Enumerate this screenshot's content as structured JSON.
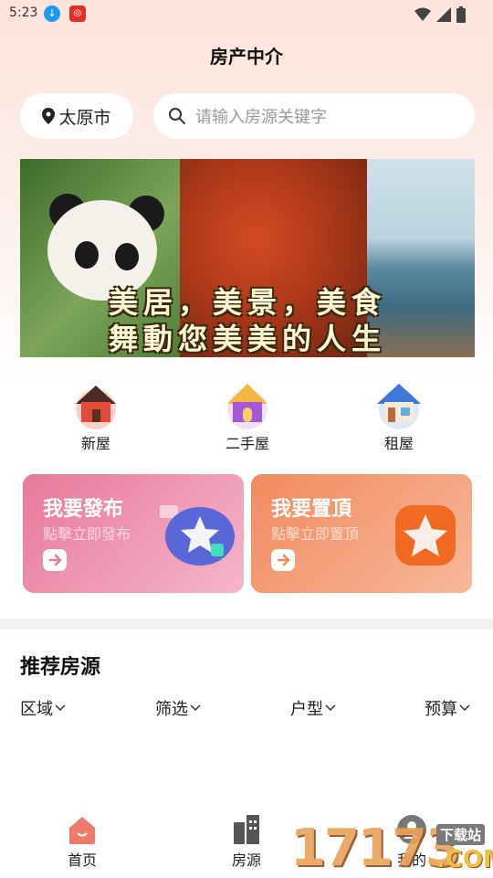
{
  "status_bar": {
    "time": "5:23"
  },
  "header": {
    "title": "房产中介"
  },
  "location": {
    "city": "太原市"
  },
  "search": {
    "placeholder": "请输入房源关键字"
  },
  "banner": {
    "line1": "美居，美景，美食",
    "line2": "舞動您美美的人生"
  },
  "categories": [
    {
      "label": "新屋",
      "icon": "red-house-icon"
    },
    {
      "label": "二手屋",
      "icon": "purple-house-icon"
    },
    {
      "label": "租屋",
      "icon": "blue-house-icon"
    }
  ],
  "cards": {
    "publish": {
      "title": "我要發布",
      "subtitle": "點擊立即發布"
    },
    "pin": {
      "title": "我要置頂",
      "subtitle": "點擊立即置頂"
    }
  },
  "section": {
    "title": "推荐房源"
  },
  "filters": [
    "区域",
    "筛选",
    "户型",
    "预算"
  ],
  "tabbar": [
    {
      "label": "首页",
      "icon": "home-icon",
      "active": true
    },
    {
      "label": "房源",
      "icon": "building-icon",
      "active": false
    },
    {
      "label": "我的",
      "icon": "user-icon",
      "active": false
    }
  ],
  "watermark": {
    "digits": "17173",
    "site": "下载站",
    "suffix": ".COM"
  },
  "colors": {
    "accent": "#f07a6a",
    "publish_card": "#e9789b",
    "pin_card": "#f28a5e"
  }
}
